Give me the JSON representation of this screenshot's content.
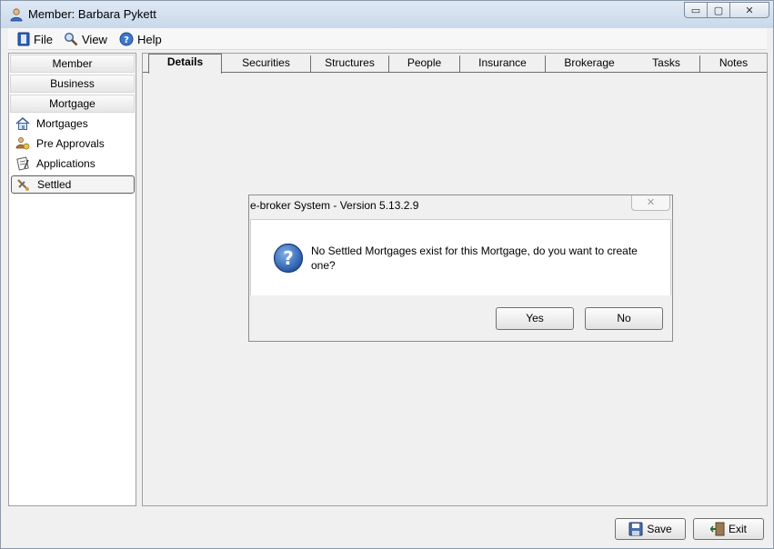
{
  "window": {
    "title": "Member: Barbara Pykett",
    "controls": {
      "minimize": "▭",
      "restore": "▢",
      "close": "✕"
    }
  },
  "menu": {
    "items": [
      {
        "label": "File",
        "icon": "file-icon"
      },
      {
        "label": "View",
        "icon": "view-icon"
      },
      {
        "label": "Help",
        "icon": "help-icon"
      }
    ]
  },
  "sidebar": {
    "categories": [
      "Member",
      "Business",
      "Mortgage"
    ],
    "items": [
      {
        "label": "Mortgages",
        "icon": "house-icon"
      },
      {
        "label": "Pre Approvals",
        "icon": "pre-approval-icon"
      },
      {
        "label": "Applications",
        "icon": "application-icon"
      },
      {
        "label": "Settled",
        "icon": "settled-icon",
        "selected": true
      }
    ]
  },
  "tabs": [
    "Details",
    "Securities",
    "Structures",
    "People",
    "Insurance",
    "Brokerage",
    "Tasks",
    "Notes"
  ],
  "active_tab": "Details",
  "footer": {
    "save_label": "Save",
    "exit_label": "Exit"
  },
  "dialog": {
    "title": "e-broker System - Version 5.13.2.9",
    "message": "No Settled Mortgages exist for this Mortgage, do you want to create one?",
    "yes_label": "Yes",
    "no_label": "No",
    "close_glyph": "✕"
  },
  "colors": {
    "question_icon": "#2b5fb3",
    "titlebar": "#c9d8ea"
  }
}
